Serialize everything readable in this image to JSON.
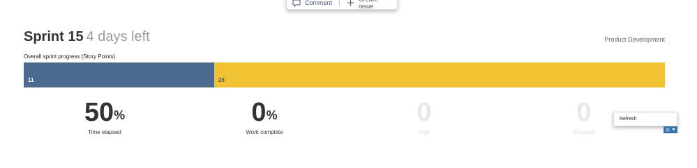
{
  "toolbar": {
    "comment_label": "Comment",
    "create_issue_label": "Create issue"
  },
  "sprint": {
    "name": "Sprint 15",
    "days_left": "4 days left",
    "project": "Product Development"
  },
  "progress": {
    "label": "Overall sprint progress (Story Points)",
    "done_value": "11",
    "todo_value": "26",
    "done_color": "#4c6a8e",
    "todo_color": "#f1c232"
  },
  "stats": [
    {
      "value": "50",
      "suffix": "%",
      "label": "Time elapsed"
    },
    {
      "value": "0",
      "suffix": "%",
      "label": "Work complete"
    },
    {
      "value": "0",
      "suffix": "",
      "label": "High"
    },
    {
      "value": "0",
      "suffix": "",
      "label": "Flagged"
    }
  ],
  "refresh": {
    "menu_label": "Refresh",
    "button_icon": "refresh-icon"
  }
}
